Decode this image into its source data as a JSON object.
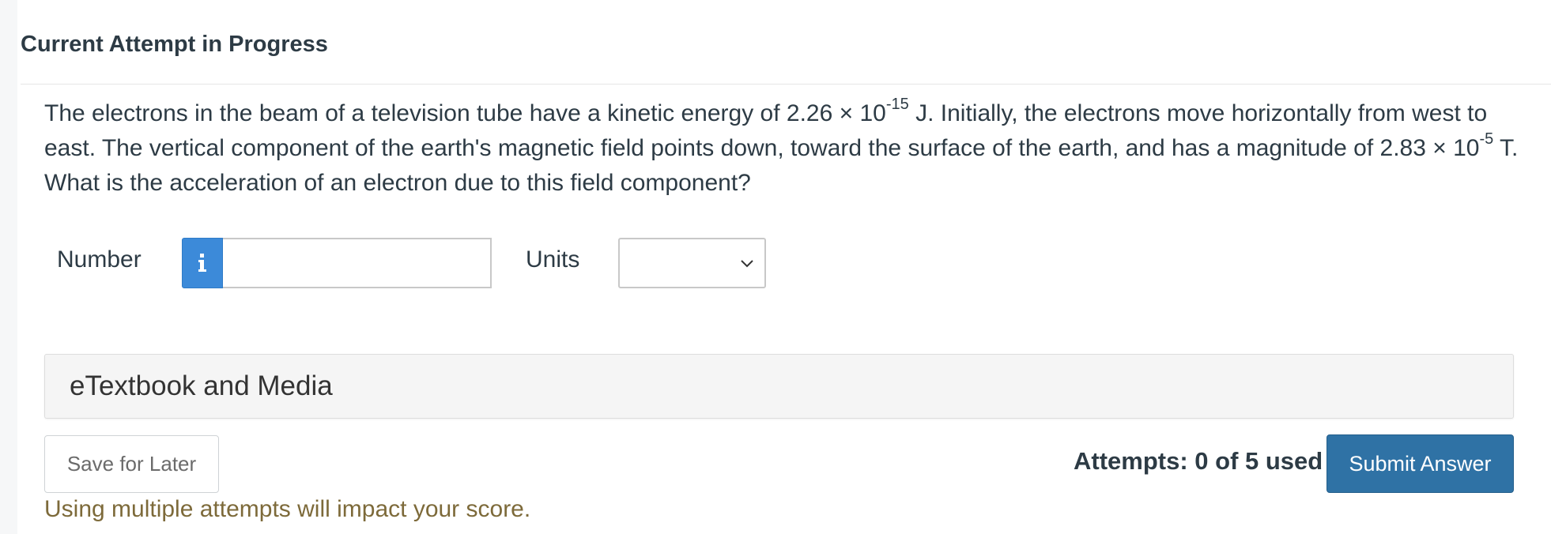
{
  "header": {
    "title": "Current Attempt in Progress"
  },
  "question": {
    "part1": "The electrons in the beam of a television tube have a kinetic energy of 2.26 × 10",
    "exp1": "-15",
    "part2": " J. Initially, the electrons move horizontally from west to east. The vertical component of the earth's magnetic field points down, toward the surface of the earth, and has a magnitude of 2.83 × 10",
    "exp2": "-5",
    "part3": " T. What is the acceleration of an electron due to this field component?"
  },
  "answer": {
    "number_label": "Number",
    "number_value": "",
    "units_label": "Units",
    "units_value": ""
  },
  "icons": {
    "info": "info-icon",
    "units_dropdown": "chevron-down-icon"
  },
  "etextbook": {
    "label": "eTextbook and Media"
  },
  "footer": {
    "save_label": "Save for Later",
    "attempts_text": "Attempts: 0 of 5 used",
    "submit_label": "Submit Answer",
    "warning_text": "Using multiple attempts will impact your score."
  },
  "colors": {
    "info_button": "#3c8ad9",
    "submit_button": "#2f72a5",
    "warning_text": "#7d6a3a",
    "text": "#2d3b45"
  }
}
